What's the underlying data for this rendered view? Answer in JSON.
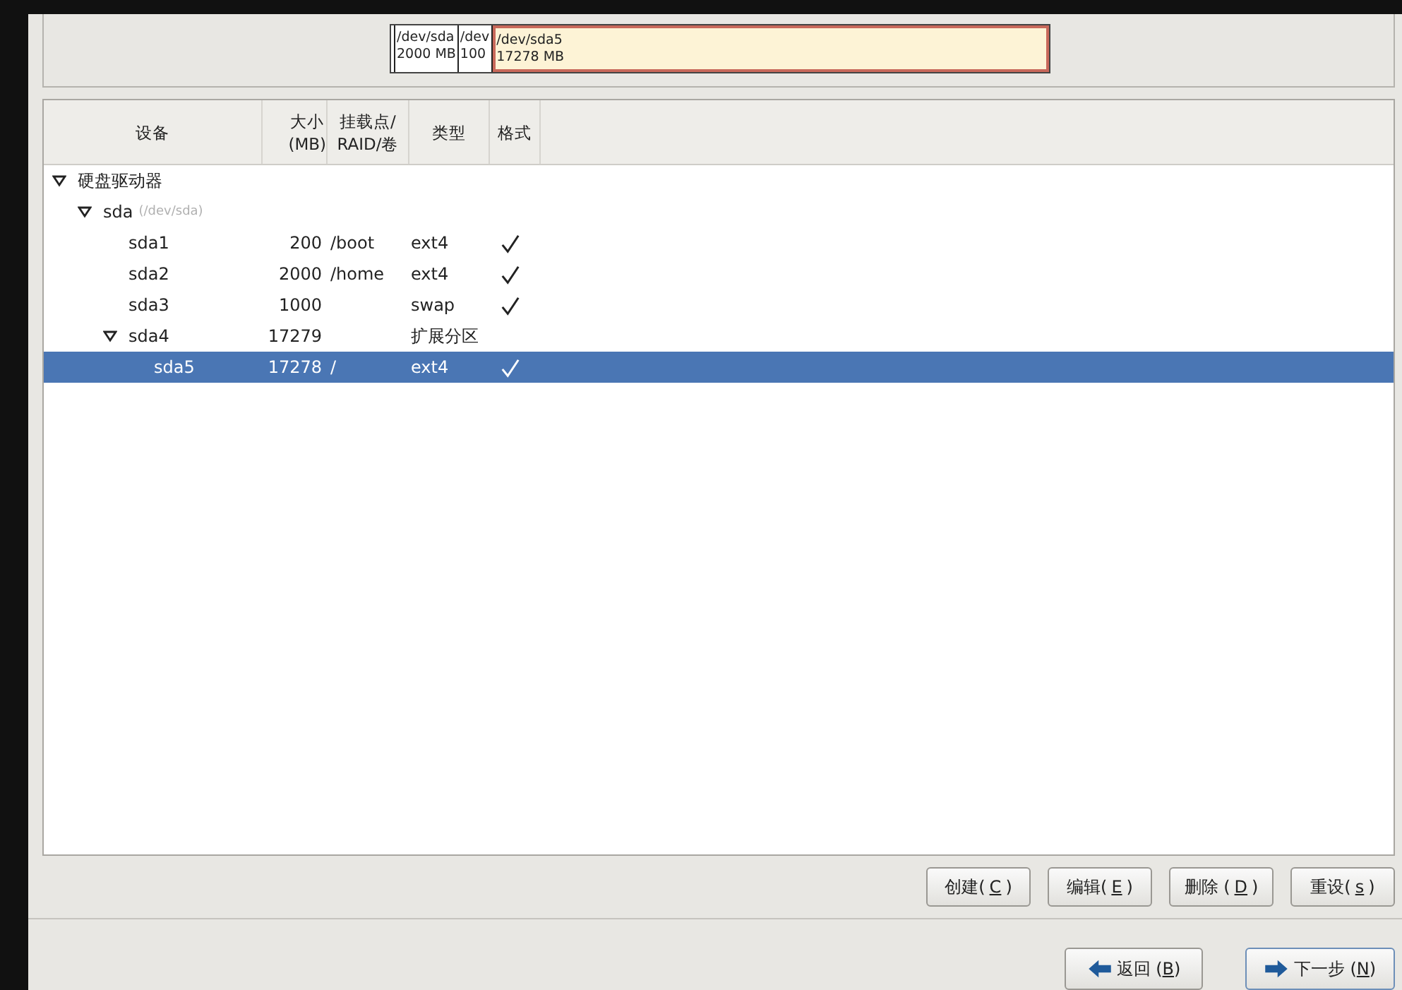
{
  "disk_map": {
    "segments": [
      {
        "selected": false,
        "kind": "sliver"
      },
      {
        "name": "/dev/sda",
        "size": "2000 MB",
        "selected": false,
        "kind": "part"
      },
      {
        "name": "/dev",
        "size": "100",
        "selected": false,
        "kind": "part"
      },
      {
        "name": "/dev/sda5",
        "size": "17278 MB",
        "selected": true,
        "kind": "part"
      }
    ]
  },
  "table": {
    "columns": [
      "设备",
      "大小\n(MB)",
      "挂载点/\nRAID/卷",
      "类型",
      "格式"
    ],
    "tree": [
      {
        "device": "硬盘驱动器",
        "format": false,
        "expanded": true,
        "selected": false,
        "children": [
          {
            "device": "sda",
            "note": "(/dev/sda)",
            "format": false,
            "expanded": true,
            "selected": false,
            "children": [
              {
                "device": "sda1",
                "size": "200",
                "mount": "/boot",
                "type": "ext4",
                "format": true,
                "selected": false
              },
              {
                "device": "sda2",
                "size": "2000",
                "mount": "/home",
                "type": "ext4",
                "format": true,
                "selected": false
              },
              {
                "device": "sda3",
                "size": "1000",
                "type": "swap",
                "format": true,
                "selected": false
              },
              {
                "device": "sda4",
                "size": "17279",
                "type": "扩展分区",
                "format": false,
                "expanded": true,
                "selected": false,
                "children": [
                  {
                    "device": "sda5",
                    "size": "17278",
                    "mount": "/",
                    "type": "ext4",
                    "format": true,
                    "selected": true
                  }
                ]
              }
            ]
          }
        ]
      }
    ]
  },
  "actions": [
    {
      "before": "创建(",
      "key": "C",
      "after": ")"
    },
    {
      "before": "编辑(",
      "key": "E",
      "after": ")"
    },
    {
      "before": "删除 (",
      "key": "D",
      "after": ")"
    },
    {
      "before": "重设(",
      "key": "s",
      "after": ")"
    }
  ],
  "navigation": [
    {
      "kind": "back",
      "before": "返回 (",
      "key": "B",
      "after": ")"
    },
    {
      "kind": "next",
      "before": "下一步 (",
      "key": "N",
      "after": ")"
    }
  ]
}
